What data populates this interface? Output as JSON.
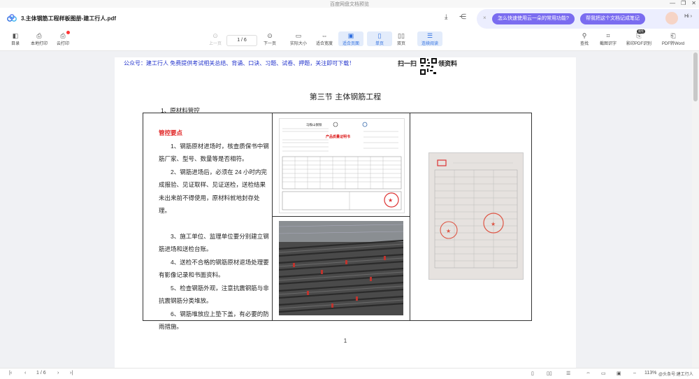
{
  "window": {
    "title": "百度网盘文档预览",
    "controls": [
      "—",
      "❐",
      "✕"
    ]
  },
  "tab": {
    "doc_title": "3.主体钢筋工程样板图册-建工行人.pdf"
  },
  "ai_bar": {
    "pill1": "怎么快速使用云一朵的常用功能?",
    "pill2": "帮我把这个文档记成笔记",
    "greet": "Hi ›"
  },
  "toolbar": {
    "outline": "目录",
    "local_print": "本地打印",
    "cloud_print": "云打印",
    "prev_page": "上一页",
    "page_indicator": "1 / 6",
    "next_page": "下一页",
    "actual_size": "实际大小",
    "fit_width": "适合宽度",
    "fit_page": "适合页面",
    "single_page": "单页",
    "double_page": "双页",
    "continuous": "连续阅读",
    "search": "查找",
    "screenshot_ocr": "截图识字",
    "scan_pdf": "影印PDF识别",
    "pdf_to_word": "PDF转Word",
    "new_badge": "限免"
  },
  "page": {
    "promo": "公众号：建工行人 免费提供考试相关总结、背诵、口诀、习题、试卷、押题，关注即可下载！",
    "scan_left": "扫一扫",
    "scan_right": "领资料",
    "section_title": "第三节  主体钢筋工程",
    "subsection": "1、原材料管控",
    "control_heading": "管控要点",
    "point1": "1、钢筋原材进场时，核查质保书中钢筋厂家、型号、数量等是否相符。",
    "point2": "2、钢筋进场后，必须在 24 小时内完成报验、见证取样、见证送检，送检结果未出来前不得使用，原材料就地封存处理。",
    "point3": "3、施工单位、监理单位要分别建立钢筋进场和送检台账。",
    "point4": "4、送检不合格的钢筋原材退场处理要有影像记录和书面资料。",
    "point5": "5、检查钢筋外观，注意抗震钢筋与非抗震钢筋分类堆放。",
    "point6": "6、钢筋堆放应上垫下盖，有必要的防雨措施。",
    "cert_company": "马鞍山钢铁",
    "cert_title": "产品质量证明书",
    "page_number": "1"
  },
  "bottom": {
    "page_indicator": "1 / 6",
    "zoom": "113%",
    "watermark": "@头条号:建工行人"
  },
  "colors": {
    "accent": "#2f6fe0",
    "ai_pill": "#7a6cf0",
    "heading_red": "#e02020",
    "promo_blue": "#2233cc"
  }
}
